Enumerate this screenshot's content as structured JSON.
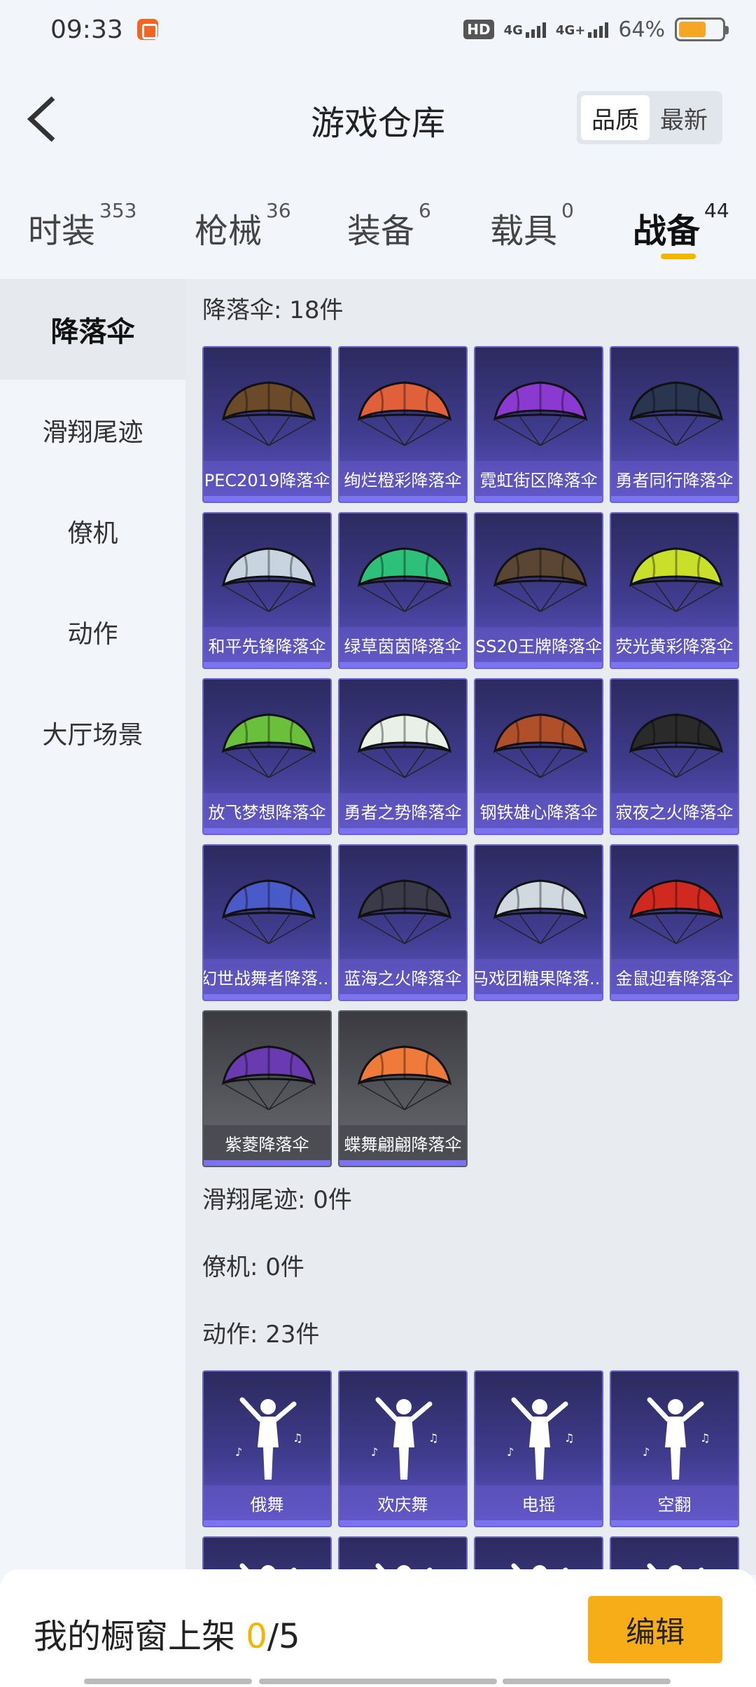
{
  "status_bar": {
    "time": "09:33",
    "hd": "HD",
    "net1": "4G",
    "net2": "4G+",
    "battery_text": "64%",
    "battery_level": 0.64,
    "battery_color": "#f5a623"
  },
  "header": {
    "title": "游戏仓库",
    "sort_options": [
      "品质",
      "最新"
    ],
    "sort_active": 0
  },
  "tabs": [
    {
      "label": "时装",
      "count": "353"
    },
    {
      "label": "枪械",
      "count": "36"
    },
    {
      "label": "装备",
      "count": "6"
    },
    {
      "label": "载具",
      "count": "0"
    },
    {
      "label": "战备",
      "count": "44"
    }
  ],
  "active_tab": 4,
  "accent_color": "#f5b400",
  "sidebar": [
    {
      "label": "降落伞"
    },
    {
      "label": "滑翔尾迹"
    },
    {
      "label": "僚机"
    },
    {
      "label": "动作"
    },
    {
      "label": "大厅场景"
    }
  ],
  "sections": {
    "parachute": {
      "title": "降落伞: 18件",
      "items": [
        {
          "name": "PEC2019降落伞",
          "icon": "parachute-icon",
          "color": "#6b4a2a"
        },
        {
          "name": "绚烂橙彩降落伞",
          "icon": "parachute-icon",
          "color": "#e0603a"
        },
        {
          "name": "霓虹街区降落伞",
          "icon": "parachute-icon",
          "color": "#8a3ad0"
        },
        {
          "name": "勇者同行降落伞",
          "icon": "parachute-icon",
          "color": "#2a3550"
        },
        {
          "name": "和平先锋降落伞",
          "icon": "parachute-icon",
          "color": "#c8d4e0"
        },
        {
          "name": "绿草茵茵降落伞",
          "icon": "parachute-icon",
          "color": "#2ec07a"
        },
        {
          "name": "SS20王牌降落伞",
          "icon": "parachute-icon",
          "color": "#5a4632"
        },
        {
          "name": "荧光黄彩降落伞",
          "icon": "parachute-icon",
          "color": "#c8e02a"
        },
        {
          "name": "放飞梦想降落伞",
          "icon": "parachute-icon",
          "color": "#6ac03a"
        },
        {
          "name": "勇者之势降落伞",
          "icon": "parachute-icon",
          "color": "#e8f0e8"
        },
        {
          "name": "钢铁雄心降落伞",
          "icon": "parachute-icon",
          "color": "#b0502a"
        },
        {
          "name": "寂夜之火降落伞",
          "icon": "parachute-icon",
          "color": "#2a2a2a"
        },
        {
          "name": "幻世战舞者降落...",
          "icon": "parachute-icon",
          "color": "#4a5ac8"
        },
        {
          "name": "蓝海之火降落伞",
          "icon": "parachute-icon",
          "color": "#3a3a48"
        },
        {
          "name": "马戏团糖果降落...",
          "icon": "parachute-icon",
          "color": "#d0d8e0"
        },
        {
          "name": "金鼠迎春降落伞",
          "icon": "parachute-icon",
          "color": "#d02a20"
        },
        {
          "name": "紫菱降落伞",
          "icon": "parachute-icon",
          "color": "#6a3ab0"
        },
        {
          "name": "蝶舞翩翩降落伞",
          "icon": "parachute-icon",
          "color": "#f07a3a"
        }
      ]
    },
    "trail": {
      "title": "滑翔尾迹: 0件"
    },
    "wingman": {
      "title": "僚机: 0件"
    },
    "emote": {
      "title": "动作: 23件",
      "items": [
        {
          "name": "俄舞",
          "icon": "dancer-icon"
        },
        {
          "name": "欢庆舞",
          "icon": "dancer-icon"
        },
        {
          "name": "电摇",
          "icon": "dancer-icon"
        },
        {
          "name": "空翻",
          "icon": "dancer-icon"
        },
        {
          "name": "",
          "icon": "dancer-icon"
        },
        {
          "name": "",
          "icon": "dancer-icon"
        },
        {
          "name": "",
          "icon": "dancer-icon"
        },
        {
          "name": "",
          "icon": "dancer-icon"
        }
      ]
    }
  },
  "bottom": {
    "label": "我的橱窗上架 ",
    "current": "0",
    "total": "/5",
    "edit": "编辑"
  }
}
